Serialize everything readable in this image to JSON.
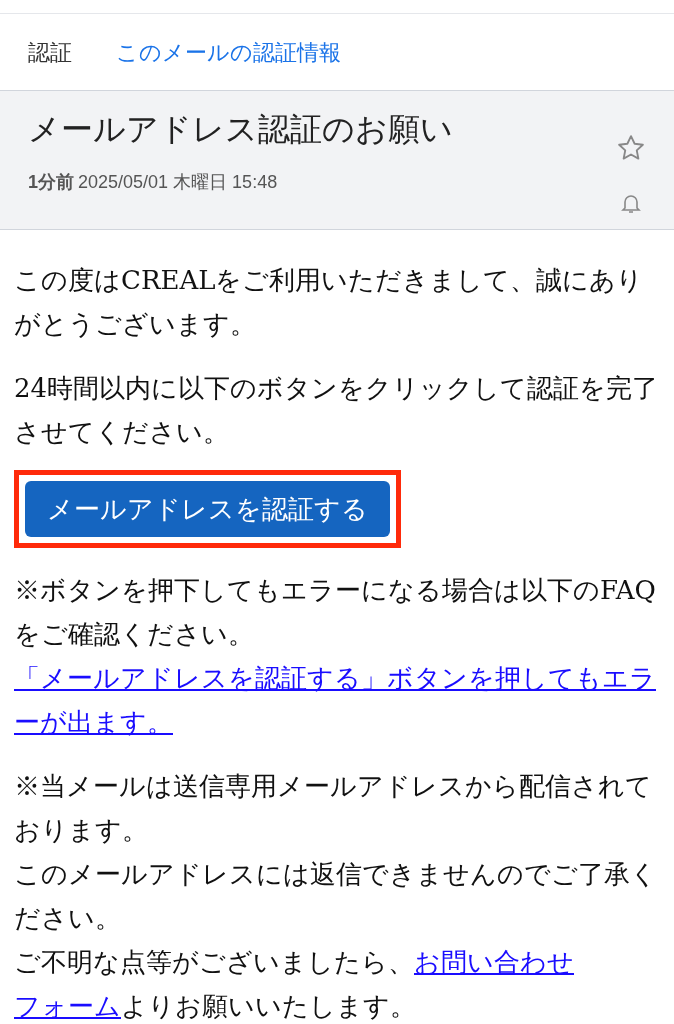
{
  "tabs": [
    {
      "label": "認証",
      "selected": false
    },
    {
      "label": "このメールの認証情報",
      "selected": true
    }
  ],
  "header": {
    "subject": "メールアドレス認証のお願い",
    "age": "1分前",
    "date": "2025/05/01 木曜日 15:48",
    "starred": false
  },
  "body": [
    {
      "kind": "text",
      "lines": [
        [
          {
            "kind": "text",
            "text": "この度はCREALをご利用いただきまして、誠にありがとうございます。"
          }
        ]
      ]
    },
    {
      "kind": "text",
      "lines": [
        [
          {
            "kind": "text",
            "text": "24時間以内に以下のボタンをクリックして認証を完了させてください。"
          }
        ]
      ]
    },
    {
      "kind": "button",
      "label": "メールアドレスを認証する",
      "highlighted": true
    },
    {
      "kind": "text",
      "lines": [
        [
          {
            "kind": "text",
            "text": "※ボタンを押下してもエラーになる場合は以下のFAQをご確認ください。"
          }
        ],
        [
          {
            "kind": "link",
            "text": "「メールアドレスを認証する」ボタンを押してもエラーが出ます。"
          }
        ]
      ]
    },
    {
      "kind": "text",
      "lines": [
        [
          {
            "kind": "text",
            "text": "※当メールは送信専用メールアドレスから配信されております。"
          }
        ],
        [
          {
            "kind": "text",
            "text": "このメールアドレスには返信できませんのでご了承ください。"
          }
        ],
        [
          {
            "kind": "text",
            "text": "ご不明な点等がございましたら、"
          },
          {
            "kind": "link",
            "text": "お問い合わせ"
          },
          {
            "kind": "link",
            "text": "フォーム"
          },
          {
            "kind": "text",
            "text": "よりお願いいたします。"
          }
        ]
      ]
    }
  ]
}
